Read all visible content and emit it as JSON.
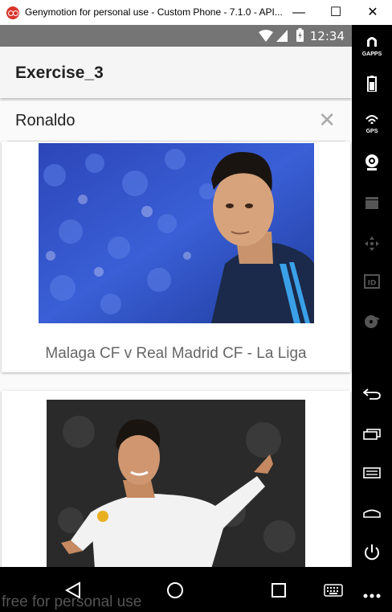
{
  "window": {
    "title": "Genymotion for personal use - Custom Phone - 7.1.0 - API...",
    "minimize_label": "—",
    "maximize_label": "☐",
    "close_label": "✕"
  },
  "status_bar": {
    "time": "12:34"
  },
  "app_bar": {
    "title": "Exercise_3"
  },
  "search": {
    "query": "Ronaldo",
    "clear_label": "✕"
  },
  "results": [
    {
      "caption": "Malaga CF v Real Madrid CF - La Liga"
    },
    {
      "caption": ""
    }
  ],
  "watermark": "free for personal use",
  "sidebar": {
    "gapps_label": "GAPPS",
    "gps_label": "GPS"
  },
  "colors": {
    "status_bar": "#757575",
    "app_bar": "#f5f5f5",
    "sidebar": "#000000"
  }
}
